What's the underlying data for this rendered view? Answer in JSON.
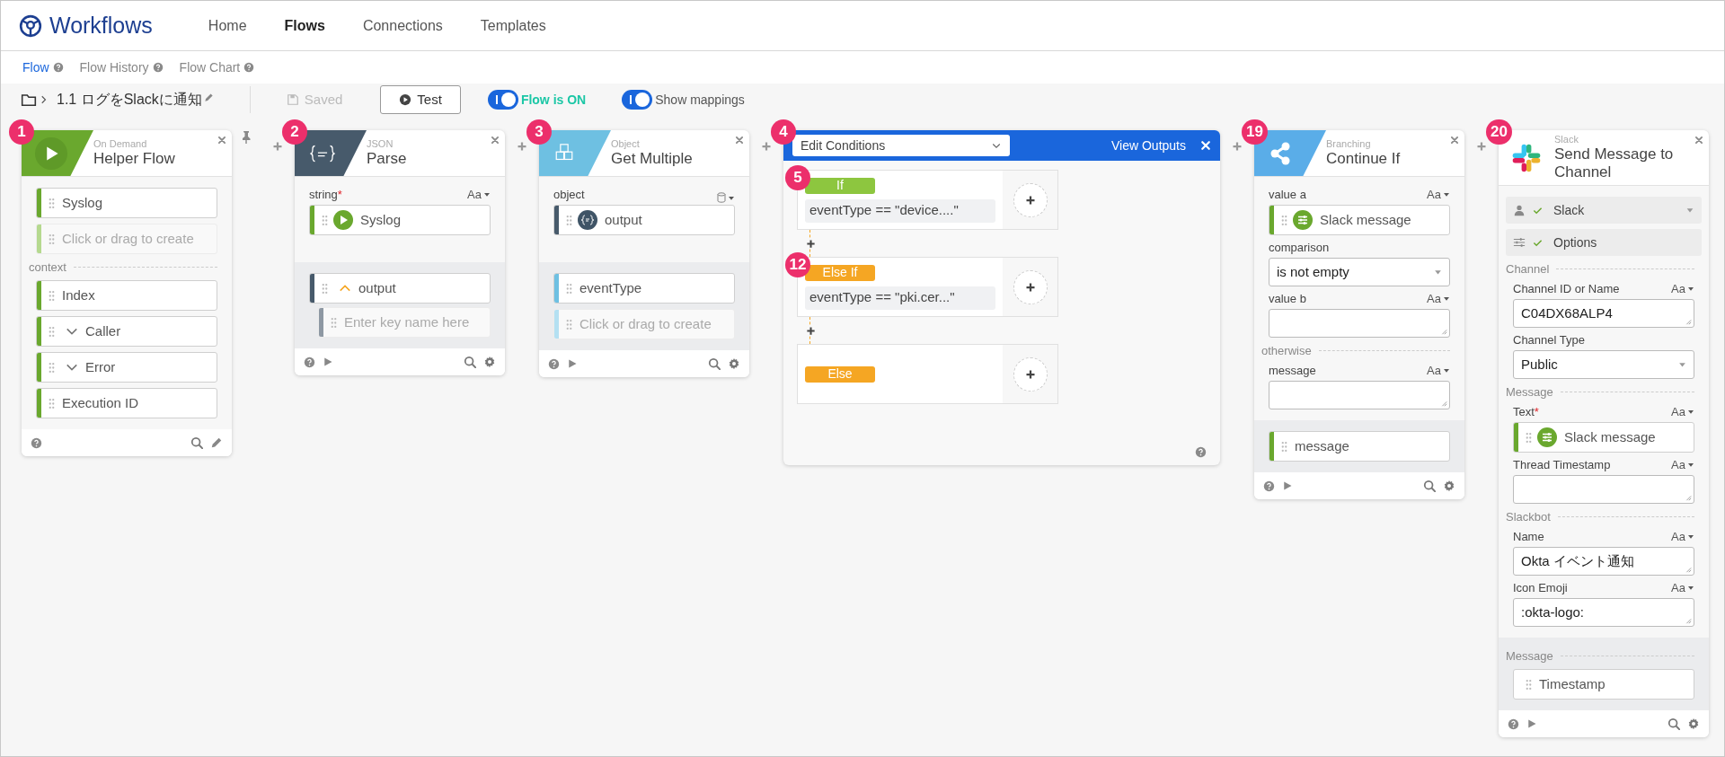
{
  "app": {
    "name": "Workflows"
  },
  "nav": [
    {
      "label": "Home",
      "selected": false
    },
    {
      "label": "Flows",
      "selected": true
    },
    {
      "label": "Connections",
      "selected": false
    },
    {
      "label": "Templates",
      "selected": false
    }
  ],
  "subnav": [
    {
      "label": "Flow",
      "selected": true
    },
    {
      "label": "Flow History",
      "selected": false
    },
    {
      "label": "Flow Chart",
      "selected": false
    }
  ],
  "toolbar": {
    "flow_name": "1.1 ログをSlackに通知",
    "saved": {
      "label": "Saved",
      "disabled": true
    },
    "test": "Test",
    "toggles": [
      {
        "kind": "status",
        "label": "Flow is ON",
        "on": true
      },
      {
        "kind": "option",
        "label": "Show mappings",
        "on": true
      }
    ]
  },
  "cards": [
    {
      "kind": "helper_flow",
      "badge": "1",
      "color": "#6aa82e",
      "category": "On Demand",
      "title": "Helper Flow",
      "pinned": true,
      "runnable": false,
      "editable": true,
      "body": [
        {
          "kind": "pill",
          "text": "Syslog",
          "color": "#6aa82e"
        },
        {
          "kind": "placeholder",
          "text": "Click or drag to create",
          "color": "#b5d98f"
        },
        {
          "kind": "divider",
          "text": "context"
        },
        {
          "kind": "pill",
          "text": "Index",
          "color": "#6aa82e"
        },
        {
          "kind": "pill",
          "text": "Caller",
          "color": "#6aa82e",
          "expanded": false
        },
        {
          "kind": "pill",
          "text": "Error",
          "color": "#6aa82e",
          "expanded": false
        },
        {
          "kind": "pill",
          "text": "Execution ID",
          "color": "#6aa82e"
        }
      ]
    },
    {
      "kind": "json",
      "badge": "2",
      "color": "#475a6b",
      "category": "JSON",
      "title": "Parse",
      "runnable": true,
      "editable": false,
      "body": [
        {
          "kind": "field",
          "label": "string",
          "required_mark": "*",
          "type_menu": {
            "kind": "text",
            "label": "Aa"
          },
          "input": {
            "kind": "pill",
            "text": "Syslog",
            "color": "#6aa82e",
            "token": {
              "kind": "flow"
            }
          }
        }
      ],
      "outputs": [
        {
          "kind": "pill",
          "text": "output",
          "color": "#475a6b",
          "expanded": true,
          "children": [
            {
              "kind": "placeholder",
              "text": "Enter key name here",
              "color": "#8e98a3"
            }
          ]
        }
      ]
    },
    {
      "kind": "object",
      "badge": "3",
      "color": "#6ec0e2",
      "category": "Object",
      "title": "Get Multiple",
      "runnable": true,
      "editable": false,
      "body": [
        {
          "kind": "field",
          "label": "object",
          "type_menu": {
            "kind": "object"
          },
          "input": {
            "kind": "pill",
            "text": "output",
            "color": "#475a6b",
            "token": {
              "kind": "json"
            }
          }
        }
      ],
      "outputs": [
        {
          "kind": "pill",
          "text": "eventType",
          "color": "#6ec0e2"
        },
        {
          "kind": "placeholder",
          "text": "Click or drag to create",
          "color": "#b4e0f2"
        }
      ]
    },
    {
      "kind": "conditions",
      "badge": "4",
      "menu": "Edit Conditions",
      "link": "View Outputs",
      "branches": [
        {
          "kind": "if",
          "badge": "5",
          "label": "If",
          "expression": "eventType == \"device....\""
        },
        {
          "kind": "else_if",
          "badge": "12",
          "label": "Else If",
          "expression": "eventType == \"pki.cer...\""
        },
        {
          "kind": "else",
          "label": "Else"
        }
      ]
    },
    {
      "kind": "branching",
      "badge": "19",
      "color": "#5aade8",
      "category": "Branching",
      "title": "Continue If",
      "runnable": true,
      "editable": false,
      "body": [
        {
          "kind": "field",
          "label": "value a",
          "type_menu": {
            "kind": "text",
            "label": "Aa"
          },
          "input": {
            "kind": "pill",
            "text": "Slack message",
            "color": "#6aa82e",
            "token": {
              "kind": "options"
            }
          }
        },
        {
          "kind": "field",
          "label": "comparison",
          "input": {
            "kind": "select",
            "value": "is not empty"
          }
        },
        {
          "kind": "field",
          "label": "value b",
          "type_menu": {
            "kind": "text",
            "label": "Aa"
          },
          "input": {
            "kind": "textarea"
          }
        },
        {
          "kind": "divider",
          "text": "otherwise"
        },
        {
          "kind": "field",
          "label": "message",
          "type_menu": {
            "kind": "text",
            "label": "Aa"
          },
          "input": {
            "kind": "textarea"
          }
        }
      ],
      "outputs": [
        {
          "kind": "pill",
          "text": "message",
          "color": "#6aa82e"
        }
      ]
    },
    {
      "kind": "slack",
      "badge": "20",
      "category": "Slack",
      "title": "Send Message to Channel",
      "runnable": true,
      "editable": false,
      "body": [
        {
          "kind": "account",
          "text": "Slack",
          "verified": true
        },
        {
          "kind": "options",
          "text": "Options",
          "verified": true
        },
        {
          "kind": "divider",
          "text": "Channel"
        },
        {
          "kind": "field",
          "label": "Channel ID or Name",
          "type_menu": {
            "kind": "text",
            "label": "Aa"
          },
          "input": {
            "kind": "textarea",
            "value": "C04DX68ALP4"
          }
        },
        {
          "kind": "field",
          "label": "Channel Type",
          "input": {
            "kind": "select",
            "value": "Public"
          }
        },
        {
          "kind": "divider",
          "text": "Message"
        },
        {
          "kind": "field",
          "label": "Text",
          "required_mark": "*",
          "type_menu": {
            "kind": "text",
            "label": "Aa"
          },
          "input": {
            "kind": "pill",
            "text": "Slack message",
            "color": "#6aa82e",
            "token": {
              "kind": "options"
            }
          }
        },
        {
          "kind": "field",
          "label": "Thread Timestamp",
          "type_menu": {
            "kind": "text",
            "label": "Aa"
          },
          "input": {
            "kind": "textarea"
          }
        },
        {
          "kind": "divider",
          "text": "Slackbot"
        },
        {
          "kind": "field",
          "label": "Name",
          "type_menu": {
            "kind": "text",
            "label": "Aa"
          },
          "input": {
            "kind": "textarea",
            "value": "Okta イベント通知"
          }
        },
        {
          "kind": "field",
          "label": "Icon Emoji",
          "type_menu": {
            "kind": "text",
            "label": "Aa"
          },
          "input": {
            "kind": "textarea",
            "value": ":okta-logo:"
          }
        }
      ],
      "outputs": [
        {
          "kind": "divider",
          "text": "Message"
        },
        {
          "kind": "pill",
          "text": "Timestamp"
        }
      ]
    }
  ]
}
